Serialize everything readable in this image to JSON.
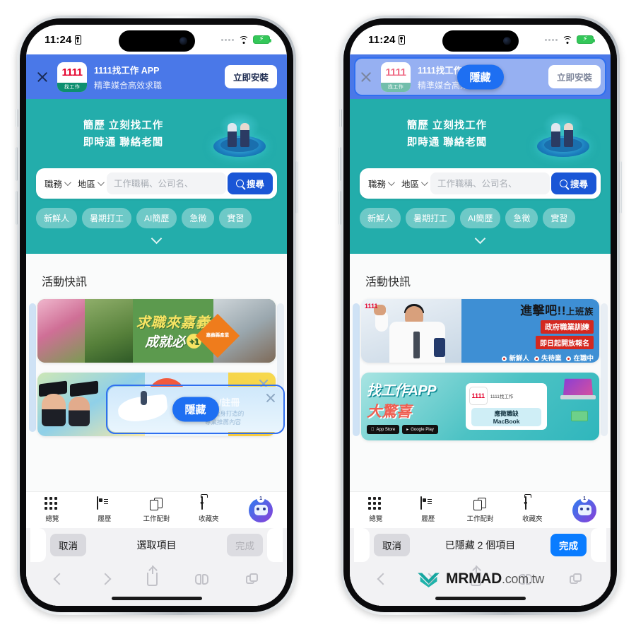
{
  "status_bar": {
    "time": "11:24",
    "lock_icon": "lock-portrait-icon",
    "signal_icon": "signal-dots-icon",
    "wifi_icon": "wifi-icon",
    "battery_icon": "battery-charging-icon",
    "battery_color": "#34c759"
  },
  "app_banner": {
    "close_icon": "close-icon",
    "app_icon_text": "1111",
    "app_icon_sub": "找工作",
    "title": "1111找工作 APP",
    "subtitle": "精準媒合高效求職",
    "install_label": "立即安裝",
    "bg_color": "#4a78e8"
  },
  "hero": {
    "line1": "簡歷 立刻找工作",
    "line2": "即時通 聯絡老闆",
    "bg_color": "#23adab",
    "art_name": "people-on-disc-illustration"
  },
  "search": {
    "role_label": "職務",
    "area_label": "地區",
    "placeholder": "工作職稱、公司名、",
    "value": "",
    "button_label": "搜尋",
    "button_color": "#1a56d6",
    "search_icon": "search-icon"
  },
  "tags": [
    "新鮮人",
    "暑期打工",
    "AI簡歷",
    "急徵",
    "實習"
  ],
  "expand_icon": "chevron-down-icon",
  "section": {
    "title": "活動快訊"
  },
  "banners": {
    "chiayi": {
      "line1": "求職來嘉義",
      "line2": "成就必",
      "plus": "+1",
      "badge_line1": "嘉義縣產業",
      "badge_line2": "徵才專區",
      "badge_line3": "嘉義縣政府"
    },
    "login": {
      "title": "登入/註冊",
      "sub1": "為您量身打造的",
      "sub2": "專業推薦內容",
      "close_icon": "close-icon"
    },
    "attack": {
      "t1_main": "進擊吧!!",
      "t1_small": "上班族",
      "t2": "政府職業訓練",
      "t3": "即日起開放報名",
      "pills": [
        "新鮮人",
        "失待業",
        "在職中"
      ],
      "logo": "1111"
    },
    "surprise": {
      "s1": "找工作APP",
      "s2": "大驚喜",
      "store1": "App Store",
      "store2": "Google Play",
      "card_logo": "1111",
      "card_title": "1111找工作",
      "pill1": "應徵職缺",
      "pill2": "MacBook"
    }
  },
  "hide_pill": {
    "label": "隱藏",
    "color": "#1e6ff2"
  },
  "tabbar": [
    {
      "label": "總覽",
      "icon": "grid-icon"
    },
    {
      "label": "履歷",
      "icon": "id-card-icon"
    },
    {
      "label": "工作配對",
      "icon": "documents-icon"
    },
    {
      "label": "收藏夾",
      "icon": "folder-heart-icon"
    },
    {
      "label": "",
      "icon": "chatbot-icon",
      "badge": "1"
    }
  ],
  "select_bar": {
    "cancel_label": "取消",
    "left_title": "選取項目",
    "right_title": "已隱藏 2 個項目",
    "done_label": "完成",
    "done_color_active": "#0a7cff"
  },
  "toolbar": {
    "back_icon": "chevron-left-icon",
    "forward_icon": "chevron-right-icon",
    "share_icon": "share-icon",
    "bookmarks_icon": "book-icon",
    "tabs_icon": "tabs-icon"
  },
  "watermark": {
    "brand": "MRMAD",
    "domain": ".com.tw",
    "mark_color": "#16a6a0"
  }
}
